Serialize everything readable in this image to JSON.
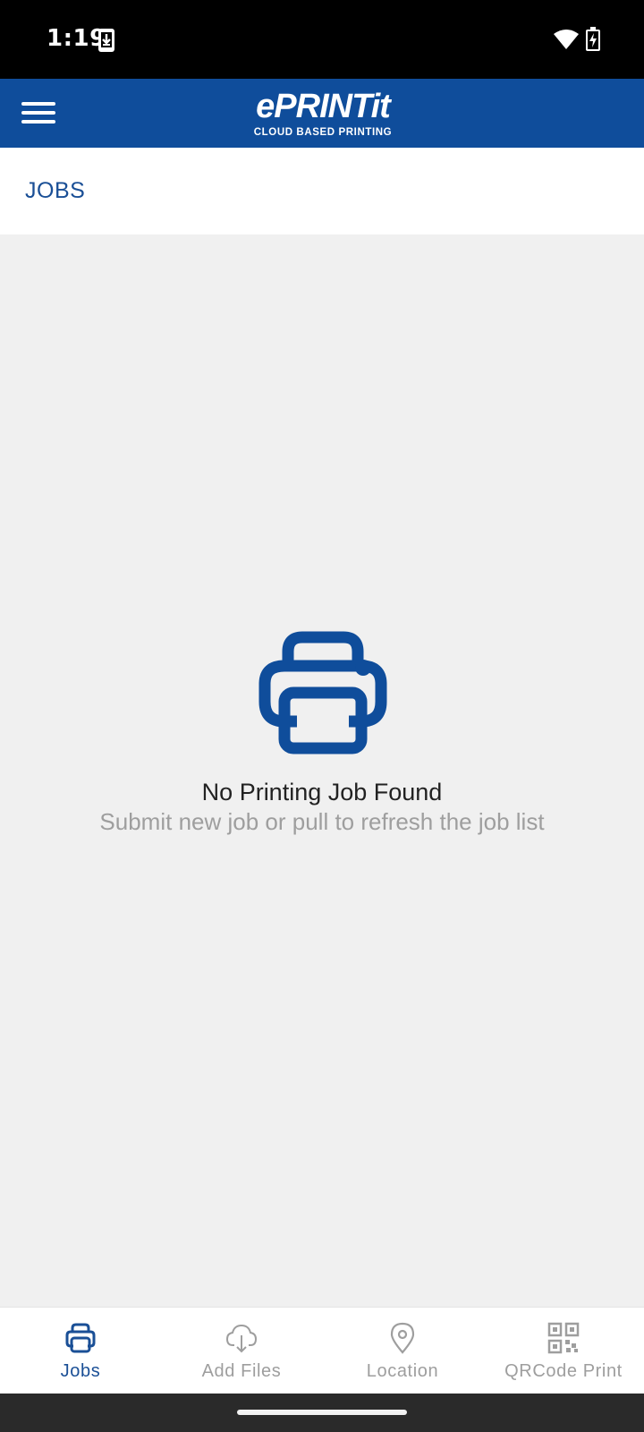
{
  "status_bar": {
    "time": "1:19",
    "icons": [
      "download-icon",
      "wifi-icon",
      "battery-charging-icon"
    ]
  },
  "app_bar": {
    "logo_main": "ePRINTit",
    "logo_sub": "CLOUD BASED PRINTING",
    "menu_icon": "hamburger-menu-icon",
    "color": "#0f4d9b"
  },
  "page": {
    "title": "JOBS"
  },
  "empty_state": {
    "icon": "printer-icon",
    "title": "No Printing Job Found",
    "subtitle": "Submit new job or pull to refresh the job list"
  },
  "bottom_nav": {
    "items": [
      {
        "label": "Jobs",
        "icon": "printer-icon",
        "active": true
      },
      {
        "label": "Add Files",
        "icon": "cloud-download-icon",
        "active": false
      },
      {
        "label": "Location",
        "icon": "location-pin-icon",
        "active": false
      },
      {
        "label": "QRCode Print",
        "icon": "qr-code-icon",
        "active": false
      }
    ],
    "active_color": "#1a4f96",
    "inactive_color": "#9e9e9e"
  }
}
